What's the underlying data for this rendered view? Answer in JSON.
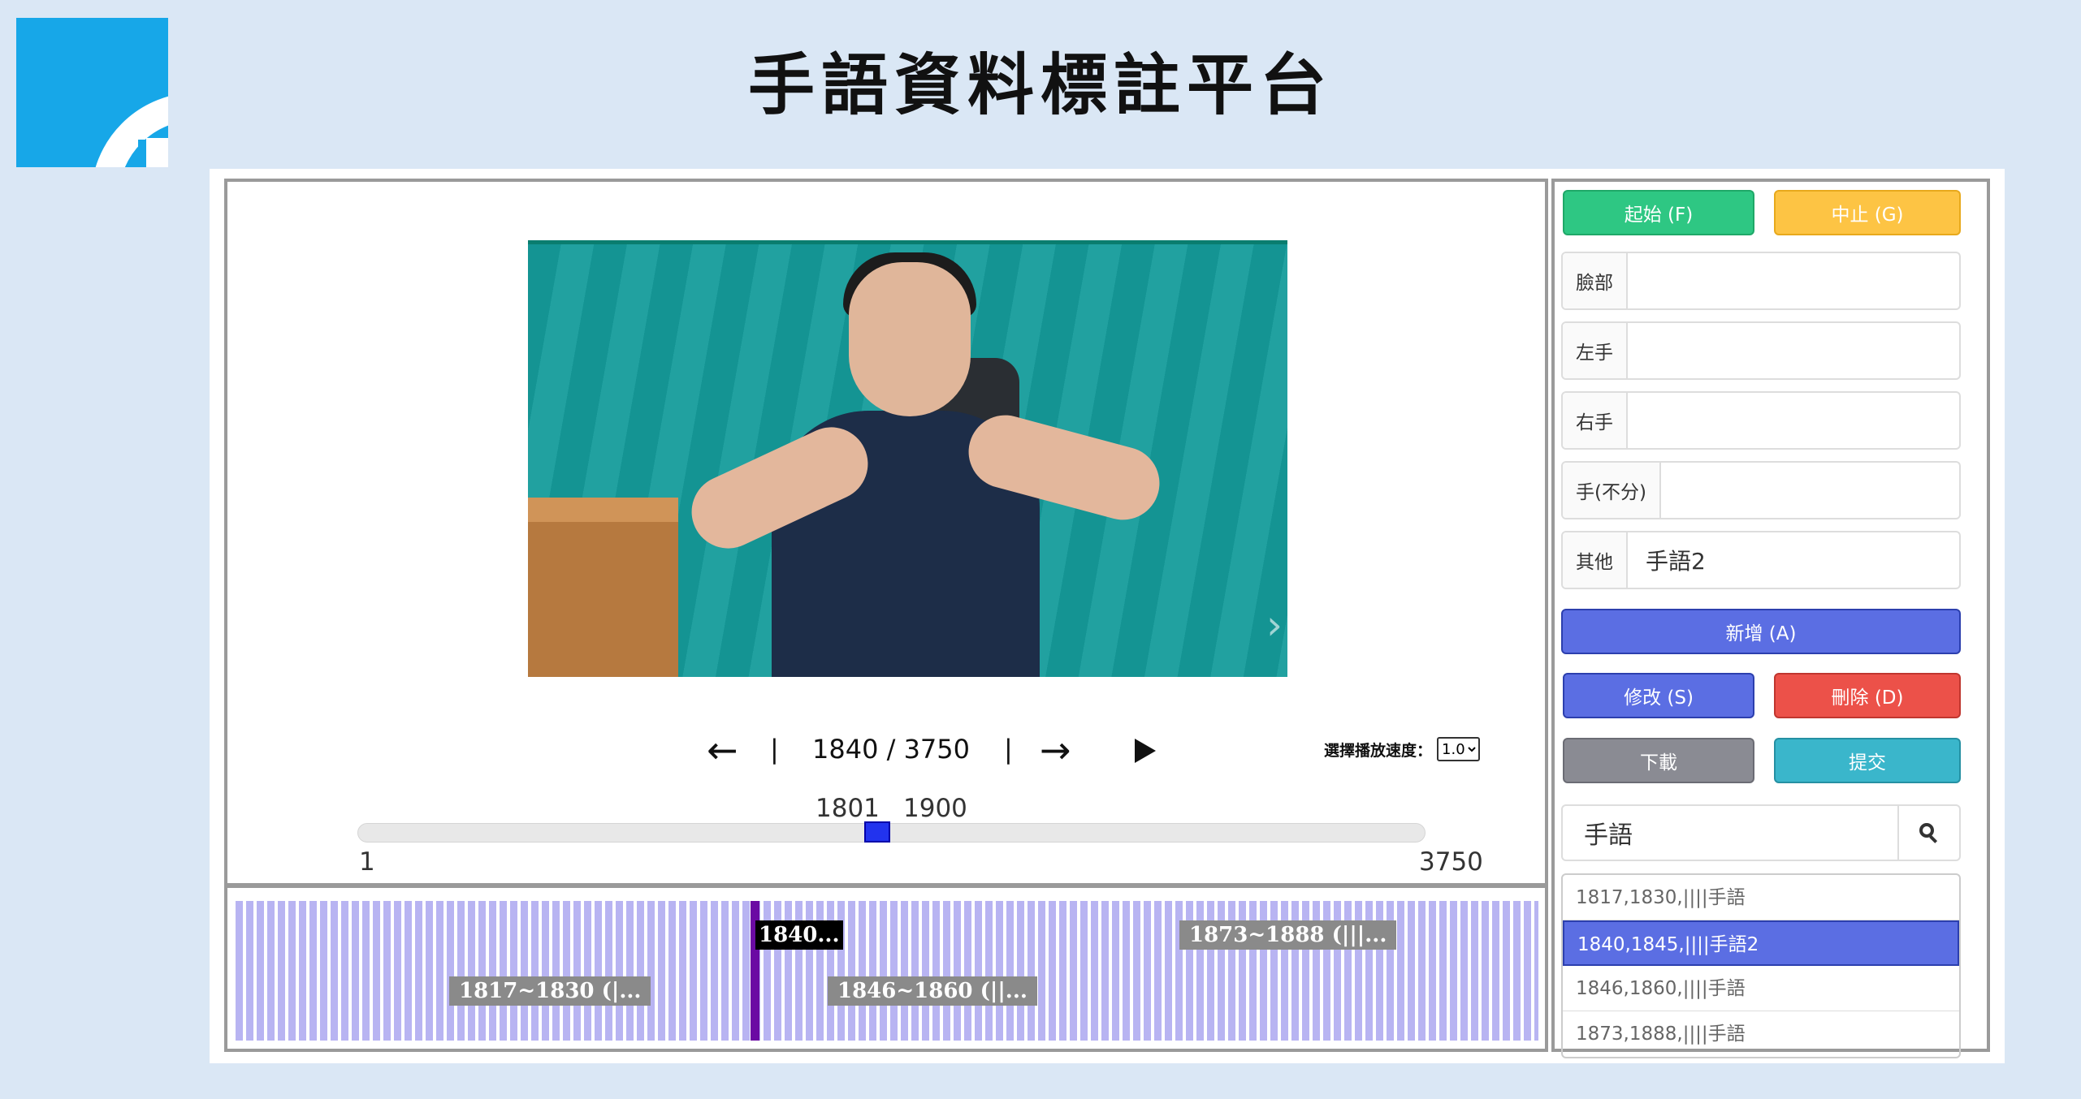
{
  "header": {
    "title": "手語資料標註平台"
  },
  "player": {
    "prev_icon": "←",
    "next_icon": "→",
    "separator": "|",
    "current_frame": "1840",
    "total_frames": "3750",
    "frame_divider": "/",
    "play_icon": "play-icon",
    "speed_label": "選擇播放速度：",
    "speed_value": "1.0"
  },
  "range": {
    "start": "1801",
    "end": "1900",
    "slider_min": "1",
    "slider_max": "3750",
    "position_fraction": 0.49
  },
  "timeline": {
    "segments": [
      {
        "label": "1817~1830 (|..."
      },
      {
        "label": "1840..."
      },
      {
        "label": "1846~1860 (||..."
      },
      {
        "label": "1873~1888 (|||..."
      }
    ]
  },
  "controls": {
    "start_label": "起始 (F)",
    "stop_label": "中止 (G)",
    "add_label": "新增 (A)",
    "edit_label": "修改 (S)",
    "delete_label": "刪除 (D)",
    "download_label": "下載",
    "submit_label": "提交"
  },
  "fields": [
    {
      "label": "臉部",
      "value": ""
    },
    {
      "label": "左手",
      "value": ""
    },
    {
      "label": "右手",
      "value": ""
    },
    {
      "label": "手(不分)",
      "value": ""
    },
    {
      "label": "其他",
      "value": "手語2"
    }
  ],
  "search": {
    "value": "手語",
    "icon": "search-icon"
  },
  "results": [
    "1817,1830,||||手語",
    "1840,1845,||||手語2",
    "1846,1860,||||手語",
    "1873,1888,||||手語"
  ],
  "colors": {
    "start": "#2ec783",
    "stop": "#fdc444",
    "add": "#5b6ee3",
    "edit": "#5b6ee3",
    "delete": "#ec5149",
    "download": "#8a8b93",
    "submit": "#3ab6cb"
  }
}
